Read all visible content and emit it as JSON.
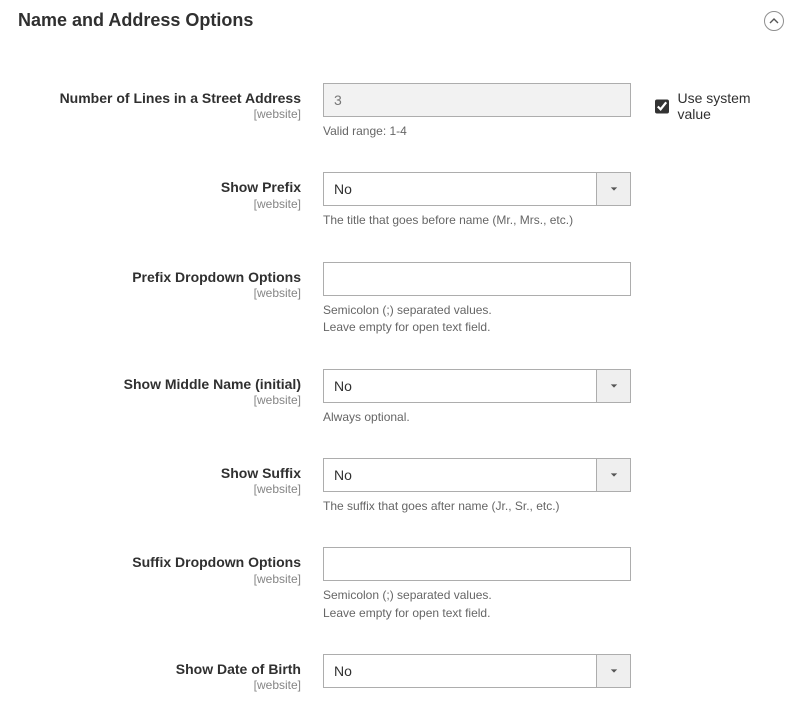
{
  "section": {
    "title": "Name and Address Options"
  },
  "scope_text": "[website]",
  "use_system_label": "Use system value",
  "fields": {
    "street_lines": {
      "label": "Number of Lines in a Street Address",
      "value": "3",
      "hint": "Valid range: 1-4",
      "use_system": true
    },
    "show_prefix": {
      "label": "Show Prefix",
      "value": "No",
      "hint": "The title that goes before name (Mr., Mrs., etc.)"
    },
    "prefix_options": {
      "label": "Prefix Dropdown Options",
      "value": "",
      "hint": "Semicolon (;) separated values.\nLeave empty for open text field."
    },
    "show_middle": {
      "label": "Show Middle Name (initial)",
      "value": "No",
      "hint": "Always optional."
    },
    "show_suffix": {
      "label": "Show Suffix",
      "value": "No",
      "hint": "The suffix that goes after name (Jr., Sr., etc.)"
    },
    "suffix_options": {
      "label": "Suffix Dropdown Options",
      "value": "",
      "hint": "Semicolon (;) separated values.\nLeave empty for open text field."
    },
    "show_dob": {
      "label": "Show Date of Birth",
      "value": "No"
    }
  }
}
